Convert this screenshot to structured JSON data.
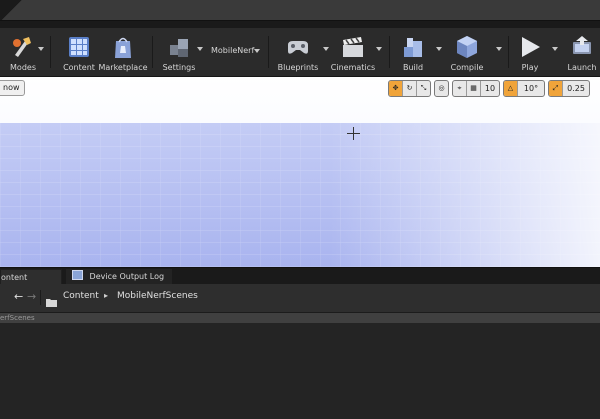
{
  "toolbar": {
    "modes": "Modes",
    "content": "Content",
    "marketplace": "Marketplace",
    "settings": "Settings",
    "platform": "MobileNerf",
    "blueprints": "Blueprints",
    "cinematics": "Cinematics",
    "build": "Build",
    "compile": "Compile",
    "play": "Play",
    "launch": "Launch"
  },
  "viewport": {
    "left_button": "now",
    "grid_snap_value": "10",
    "rotation_snap_value": "10°",
    "scale_snap_value": "0.25"
  },
  "bottom_tabs": {
    "content_browser": "ontent Browser",
    "device_output_log": "Device Output Log"
  },
  "path": {
    "root": "Content",
    "folder": "MobileNerfScenes"
  },
  "subpath": {
    "label": "erfScenes"
  }
}
